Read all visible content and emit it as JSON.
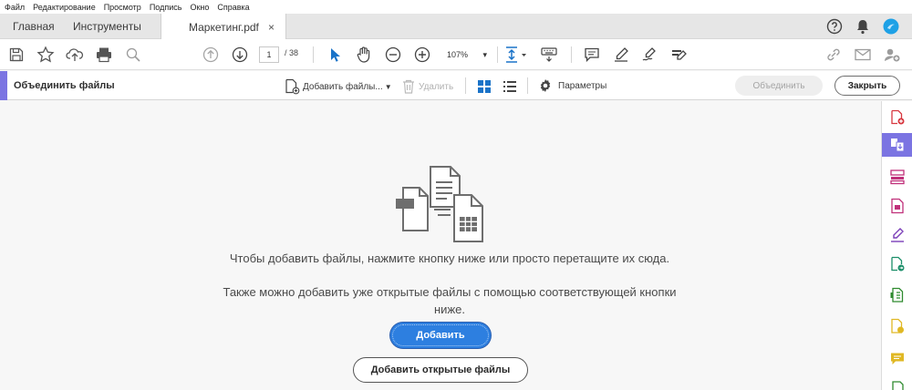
{
  "menu": [
    "Файл",
    "Редактирование",
    "Просмотр",
    "Подпись",
    "Окно",
    "Справка"
  ],
  "tabs": {
    "home": "Главная",
    "tools": "Инструменты",
    "document": "Маркетинг.pdf",
    "close": "×"
  },
  "toolbar": {
    "page_current": "1",
    "page_total": "/ 38",
    "zoom": "107%",
    "zoom_caret": "▾"
  },
  "combine_bar": {
    "title": "Объединить файлы",
    "add_files": "Добавить файлы...",
    "delete": "Удалить",
    "settings": "Параметры",
    "combine": "Объединить",
    "close": "Закрыть"
  },
  "main": {
    "message_line1": "Чтобы добавить файлы, нажмите кнопку ниже или просто перетащите их сюда.",
    "message_line2": "Также можно добавить уже открытые файлы с помощью соответствующей кнопки ниже.",
    "add_button": "Добавить",
    "add_open_button": "Добавить открытые файлы"
  },
  "colors": {
    "accent": "#7b74e2",
    "primary_button": "#2d7fe0",
    "pointer_icon": "#1a73c8"
  }
}
